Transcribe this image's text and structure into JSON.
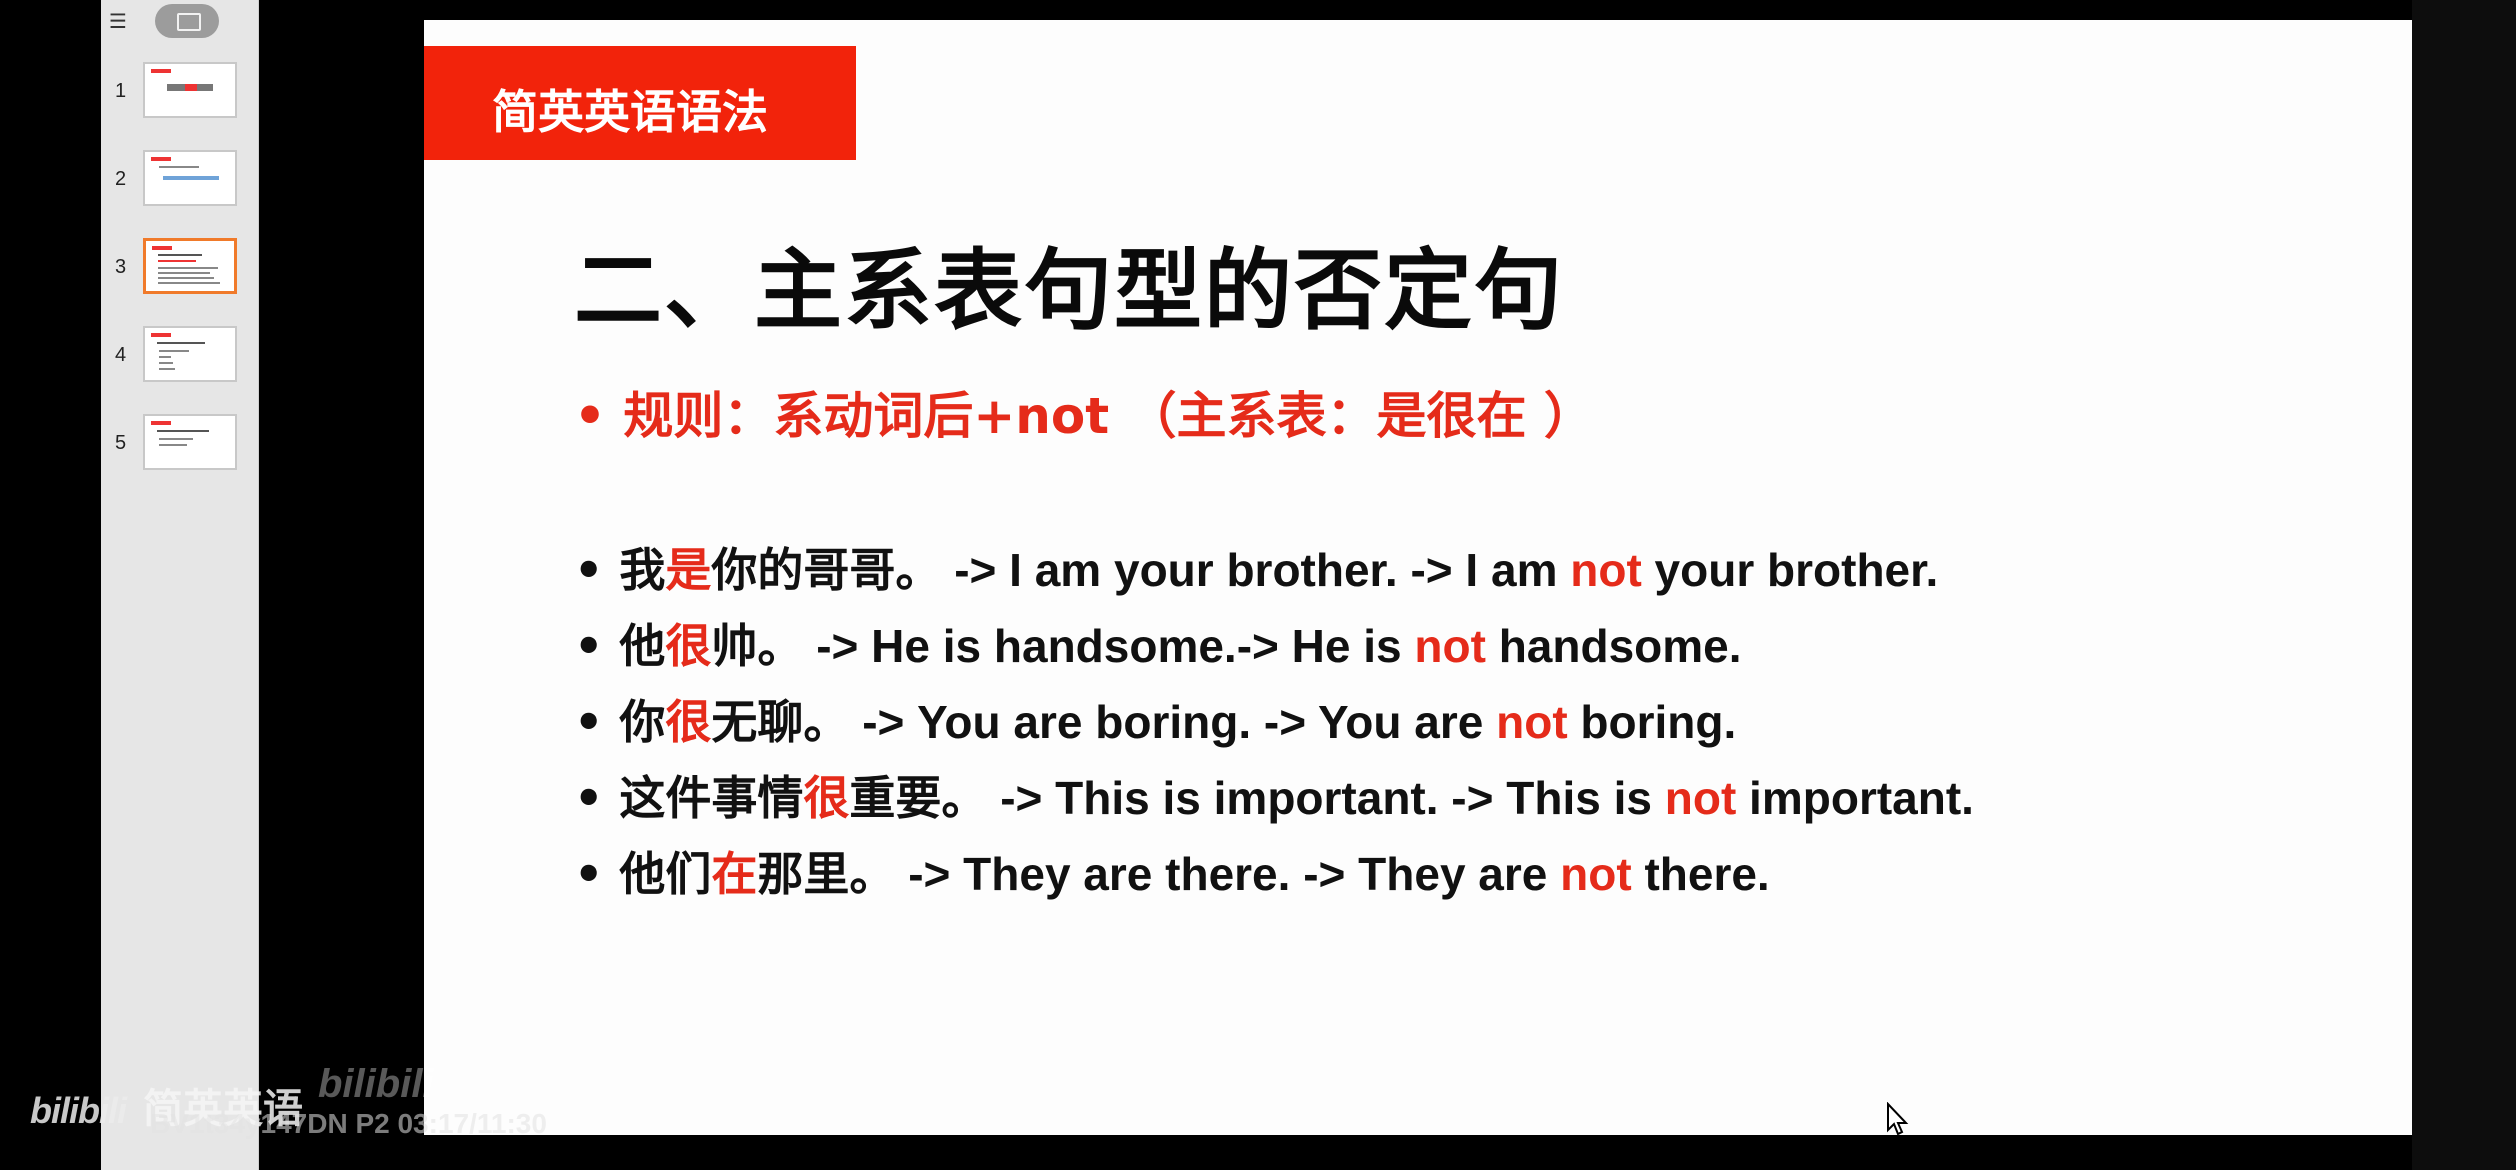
{
  "thumbnail_panel": {
    "outline_icon": "outline-list-icon",
    "slide_view_icon": "slide-view-icon",
    "slides": [
      {
        "number": "1"
      },
      {
        "number": "2"
      },
      {
        "number": "3",
        "selected": true
      },
      {
        "number": "4"
      },
      {
        "number": "5"
      }
    ]
  },
  "watermark": {
    "logo": "bilibili",
    "channel": "简英英语",
    "info": "BV1t34y147DN P2 03:17/11:30"
  },
  "slide": {
    "banner": "简英英语语法",
    "title": "二、主系表句型的否定句",
    "rule": "• 规则：系动词后+not （主系表：是很在 ）",
    "bullets": [
      {
        "b": "• ",
        "zh_pre": "我",
        "zh_red": "是",
        "zh_post": "你的哥哥。",
        "en_pre": " -> I am your brother. -> I am ",
        "not": "not",
        "en_post": " your brother."
      },
      {
        "b": "• ",
        "zh_pre": "他",
        "zh_red": "很",
        "zh_post": "帅。",
        "en_pre": " -> He is handsome.-> He is ",
        "not": "not",
        "en_post": " handsome."
      },
      {
        "b": "• ",
        "zh_pre": "你",
        "zh_red": "很",
        "zh_post": "无聊。",
        "en_pre": " -> You are boring. -> You are ",
        "not": "not",
        "en_post": " boring."
      },
      {
        "b": "• ",
        "zh_pre": "这件事情",
        "zh_red": "很",
        "zh_post": "重要。",
        "en_pre": " -> This is important. -> This is ",
        "not": "not",
        "en_post": " important."
      },
      {
        "b": "• ",
        "zh_pre": "他们",
        "zh_red": "在",
        "zh_post": "那里。",
        "en_pre": " -> They are there. -> They are ",
        "not": "not",
        "en_post": " there."
      }
    ]
  },
  "colors": {
    "banner": "#f2230b",
    "highlight": "#e52b1a",
    "selected_border": "#f07a2a"
  }
}
